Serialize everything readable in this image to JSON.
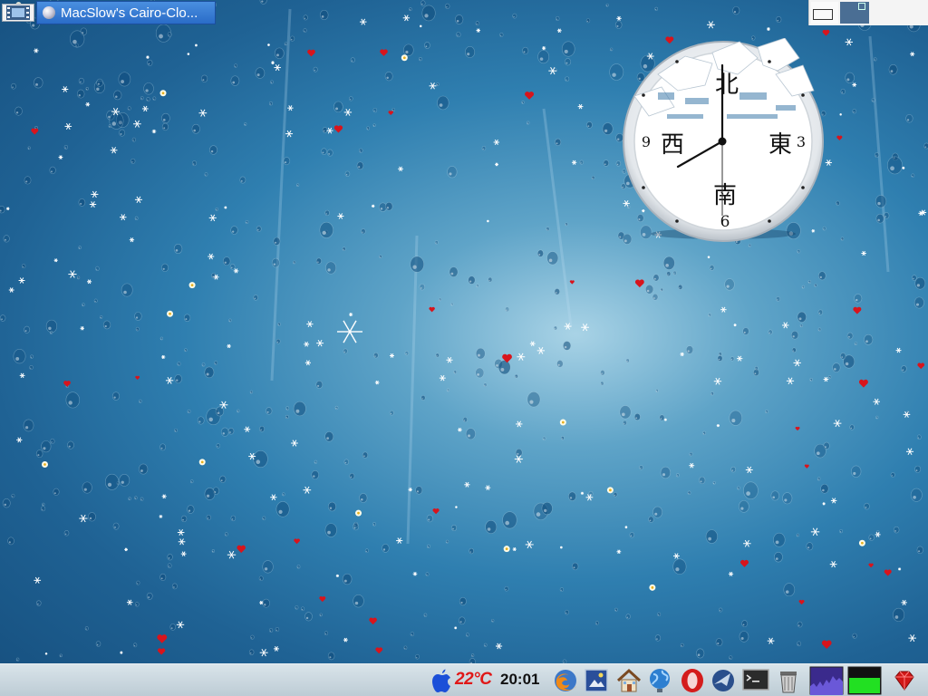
{
  "top_panel": {
    "menu_icon": "film-icon",
    "task_title": "MacSlow's Cairo-Clo..."
  },
  "clock": {
    "numerals": {
      "nine": "9",
      "three": "3",
      "six": "6"
    },
    "cardinals": {
      "north": "北",
      "west": "西",
      "east": "東",
      "south": "南"
    }
  },
  "bottom_panel": {
    "temperature": "22°C",
    "time": "20:01"
  },
  "colors": {
    "accent": "#2a6cc8",
    "temperature_red": "#e01818"
  }
}
